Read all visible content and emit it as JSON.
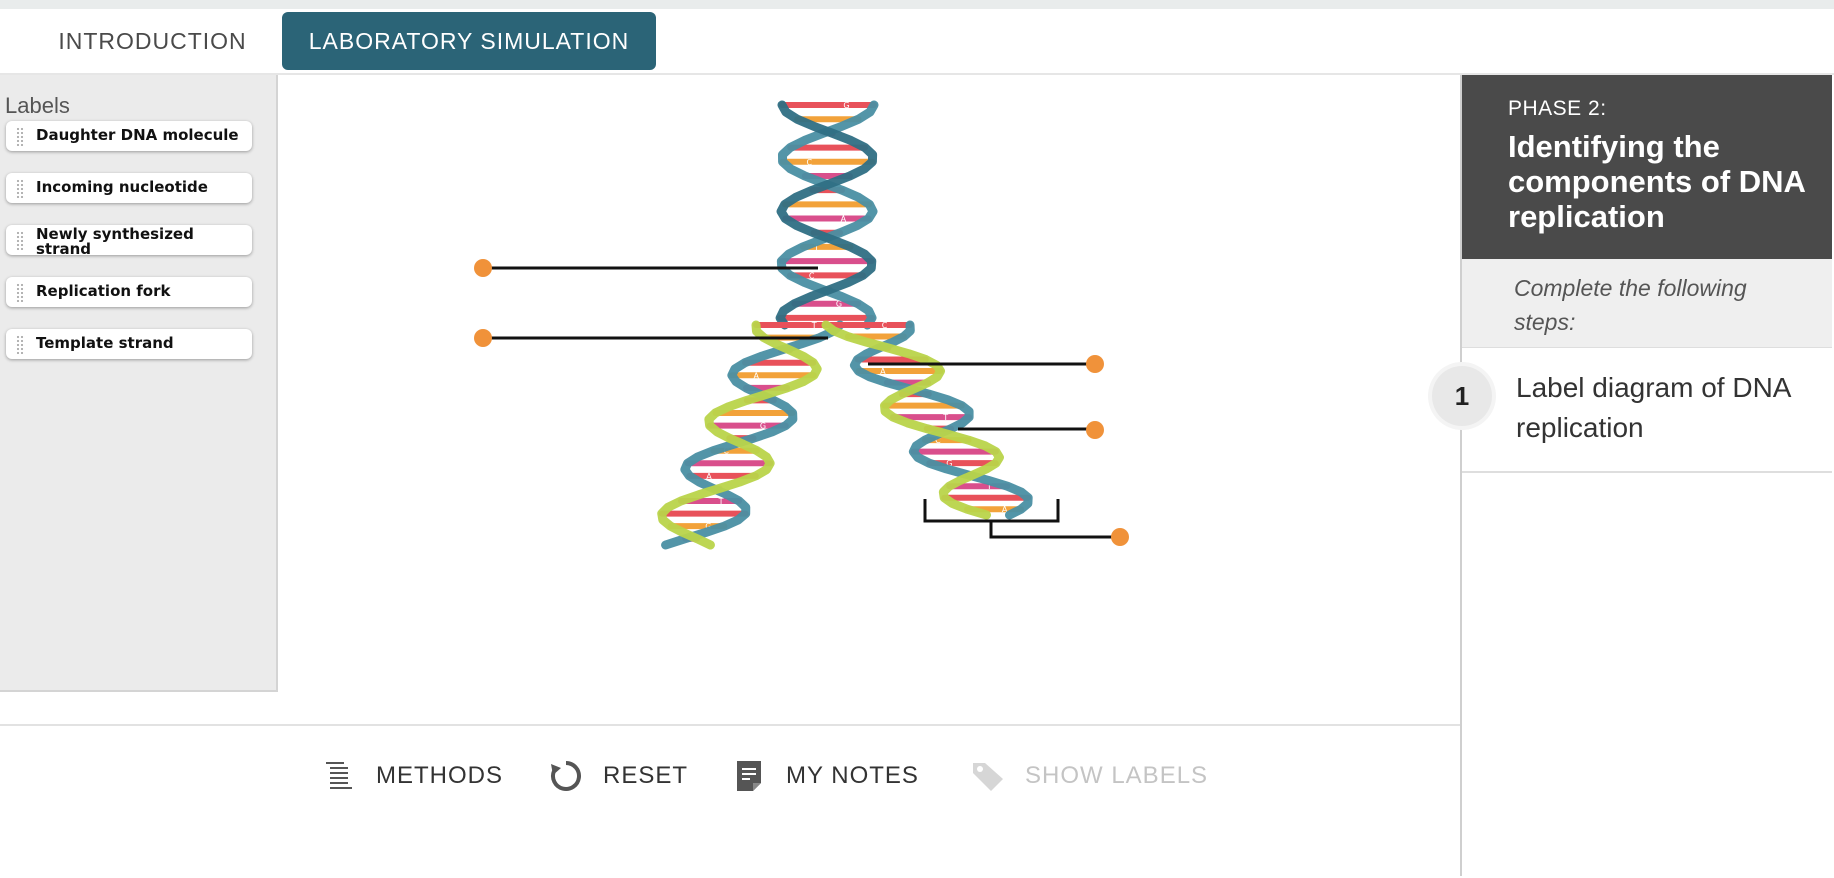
{
  "tabs": [
    {
      "label": "INTRODUCTION",
      "active": false
    },
    {
      "label": "LABORATORY SIMULATION",
      "active": true
    }
  ],
  "labels_panel": {
    "title": "Labels",
    "items": [
      {
        "label": "Daughter DNA molecule"
      },
      {
        "label": "Incoming nucleotide"
      },
      {
        "label": "Newly synthesized strand"
      },
      {
        "label": "Replication fork"
      },
      {
        "label": "Template strand"
      }
    ]
  },
  "diagram": {
    "subject": "DNA replication",
    "drop_target_count": 5,
    "colors": {
      "target": "#f0923a",
      "backbone": "#4a8fa3",
      "new_backbone": "#b9d44a"
    },
    "base_letters": [
      "G",
      "C",
      "A",
      "T",
      "C",
      "G",
      "T",
      "A",
      "G",
      "C",
      "A",
      "T"
    ]
  },
  "toolbar": {
    "methods": "METHODS",
    "reset": "RESET",
    "notes": "MY NOTES",
    "show_labels": "SHOW LABELS",
    "show_labels_enabled": false
  },
  "phase": {
    "label": "PHASE 2:",
    "title": "Identifying the components of DNA replication",
    "intro": "Complete the following steps:",
    "steps": [
      {
        "number": "1",
        "text": "Label diagram of DNA replication"
      }
    ]
  },
  "colors": {
    "accent": "#2b6477",
    "phase_header": "#4a4a4a"
  }
}
